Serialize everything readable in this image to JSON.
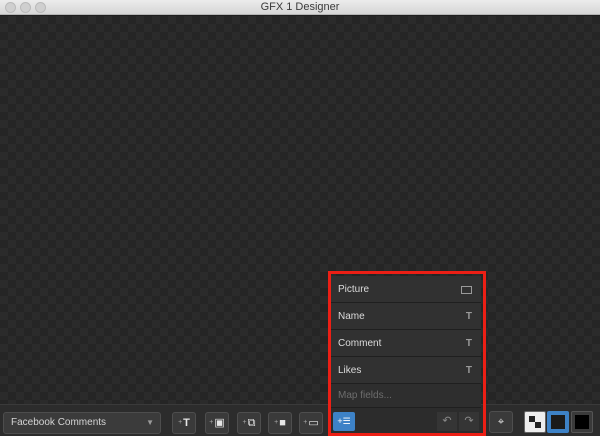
{
  "window": {
    "title": "GFX 1 Designer"
  },
  "toolbar": {
    "template_select": "Facebook Comments",
    "add_text_icon": "add-text-icon",
    "add_image_icon": "add-image-icon",
    "add_gallery_icon": "add-gallery-icon",
    "add_video_icon": "add-video-icon",
    "add_window_icon": "add-window-icon",
    "map_fields_icon": "map-fields-icon",
    "undo_icon": "undo-icon",
    "redo_icon": "redo-icon",
    "focus_icon": "focus-icon",
    "accent_color": "#3d82c7"
  },
  "map_panel": {
    "fields": [
      {
        "label": "Picture",
        "icon": "image-icon"
      },
      {
        "label": "Name",
        "icon": "text-icon"
      },
      {
        "label": "Comment",
        "icon": "text-icon"
      },
      {
        "label": "Likes",
        "icon": "text-icon"
      }
    ],
    "placeholder": "Map fields...",
    "highlight_color": "#ec1f15"
  }
}
